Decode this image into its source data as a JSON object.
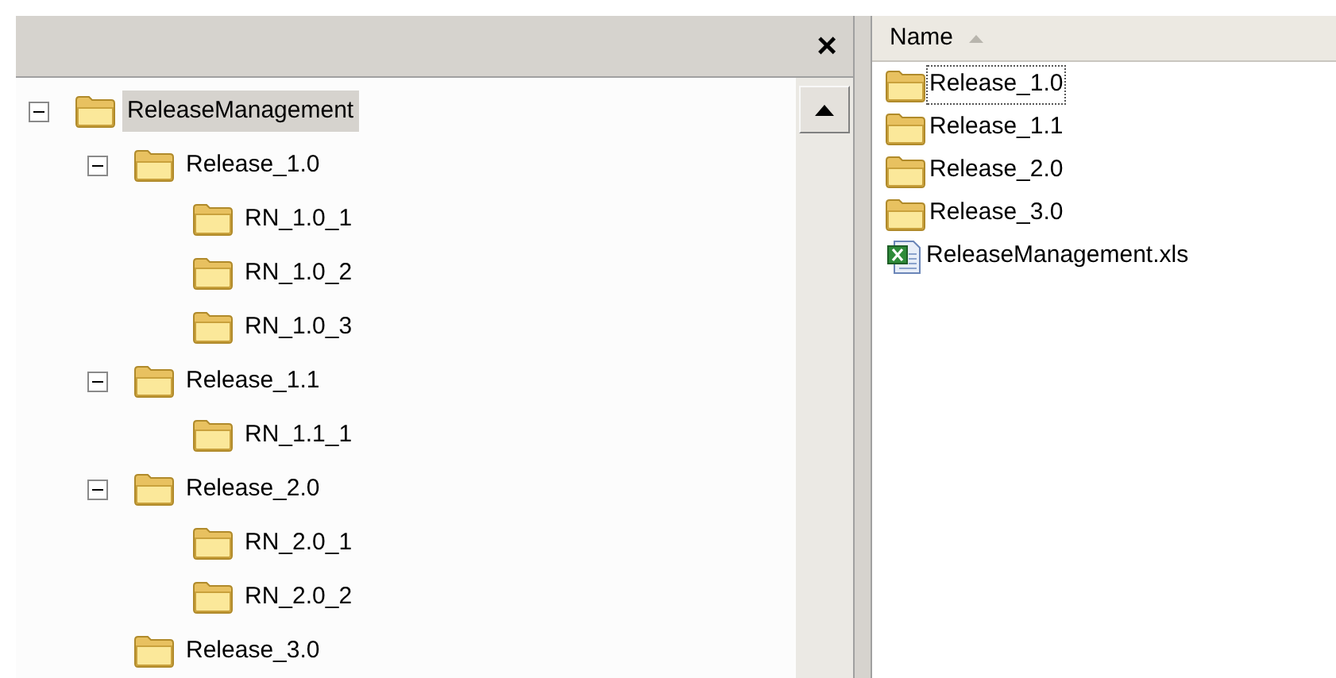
{
  "folder_pane": {
    "close_button": "×",
    "tree": [
      {
        "label": "ReleaseManagement",
        "selected": true,
        "expanded": true,
        "children": [
          {
            "label": "Release_1.0",
            "selected": false,
            "expanded": true,
            "children": [
              {
                "label": "RN_1.0_1",
                "selected": false
              },
              {
                "label": "RN_1.0_2",
                "selected": false
              },
              {
                "label": "RN_1.0_3",
                "selected": false
              }
            ]
          },
          {
            "label": "Release_1.1",
            "selected": false,
            "expanded": true,
            "children": [
              {
                "label": "RN_1.1_1",
                "selected": false
              }
            ]
          },
          {
            "label": "Release_2.0",
            "selected": false,
            "expanded": true,
            "children": [
              {
                "label": "RN_2.0_1",
                "selected": false
              },
              {
                "label": "RN_2.0_2",
                "selected": false
              }
            ]
          },
          {
            "label": "Release_3.0",
            "selected": false
          }
        ]
      }
    ]
  },
  "file_list": {
    "columns": [
      {
        "label": "Name",
        "sorted": true
      }
    ],
    "items": [
      {
        "name": "Release_1.0",
        "kind": "folder",
        "focused": true
      },
      {
        "name": "Release_1.1",
        "kind": "folder",
        "focused": false
      },
      {
        "name": "Release_2.0",
        "kind": "folder",
        "focused": false
      },
      {
        "name": "Release_3.0",
        "kind": "folder",
        "focused": false
      },
      {
        "name": "ReleaseManagement.xls",
        "kind": "spreadsheet",
        "focused": false
      }
    ]
  }
}
